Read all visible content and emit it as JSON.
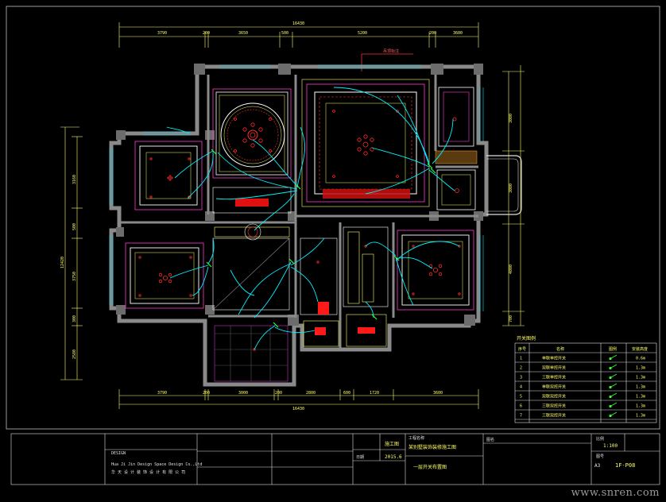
{
  "drawing": {
    "top_total_dim": "16430",
    "top_dims": [
      "3790",
      "200",
      "3650",
      "500",
      "5200",
      "200",
      "3600"
    ],
    "bottom_total_dim": "16430",
    "bottom_dims": [
      "3790",
      "200",
      "3000",
      "200",
      "2800",
      "600",
      "1720",
      "3600"
    ],
    "left_dims": [
      "3160",
      "500",
      "3750",
      "300",
      "2580"
    ],
    "left_total": "12420",
    "right_dims": [
      "3000",
      "3000",
      "4000",
      "700"
    ],
    "label_top": "吊顶标注"
  },
  "legend": {
    "title": "开关图例",
    "headers": [
      "序号",
      "名称",
      "图例",
      "安装高度"
    ],
    "rows": [
      {
        "no": "1",
        "name": "单联单控开关",
        "h": "0.6m"
      },
      {
        "no": "2",
        "name": "双联单控开关",
        "h": "1.3m"
      },
      {
        "no": "3",
        "name": "三联单控开关",
        "h": "1.3m"
      },
      {
        "no": "4",
        "name": "单联双控开关",
        "h": "1.3m"
      },
      {
        "no": "5",
        "name": "双联双控开关",
        "h": "1.3m"
      },
      {
        "no": "6",
        "name": "三联双控开关",
        "h": "1.3m"
      },
      {
        "no": "7",
        "name": "三联双控开关",
        "h": "1.3m"
      }
    ],
    "symbol_color": "#33ff33"
  },
  "title_block": {
    "company_label": "DESIGN",
    "company_en": "Hua Ji Jin Design Space Design Co.,Ltd",
    "company_cn": "华 天 设 计 装 饰 设 计 有 限 公 司",
    "project_label": "工程名称",
    "project_name": "某别墅装饰装修施工图",
    "drawing_label": "图名",
    "drawing_name": "一层开关布置图",
    "date_label": "日期",
    "date_value": "2015.6",
    "stage": "施工图",
    "scale_label": "比例",
    "scale": "1:100",
    "sheet_label": "图号",
    "sheet_no": "1F-P08",
    "size": "A3"
  },
  "watermark": "www.snren.com",
  "colors": {
    "wall": "#7a7a7a",
    "cyan": "#00ffff",
    "magenta": "#ff33ff",
    "yellow": "#ffff33",
    "red": "#ff2020",
    "white": "#ffffff",
    "green": "#33ff33"
  }
}
